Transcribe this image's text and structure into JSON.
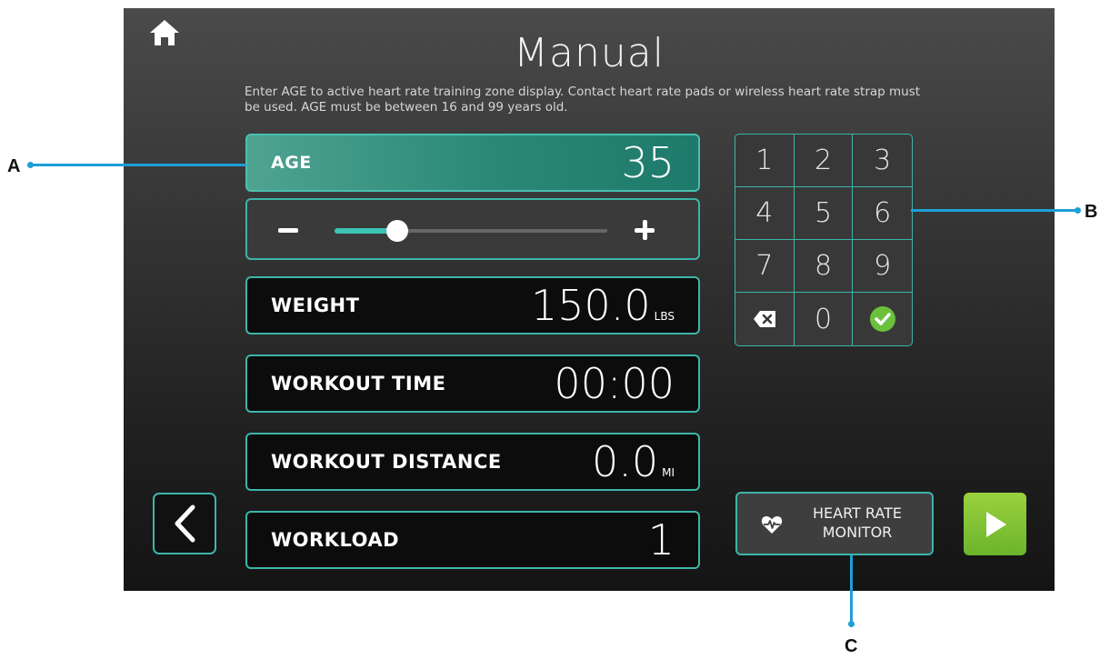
{
  "screen": {
    "title": "Manual",
    "instructions": "Enter AGE to active heart rate training zone display. Contact heart rate pads or wireless heart rate strap must be used. AGE must be between 16 and 99 years old."
  },
  "fields": {
    "age": {
      "label": "AGE",
      "value": "35"
    },
    "weight": {
      "label": "WEIGHT",
      "value": "150.0",
      "unit": "LBS"
    },
    "workout_time": {
      "label": "WORKOUT TIME",
      "value": "00:00"
    },
    "workout_distance": {
      "label": "WORKOUT DISTANCE",
      "value": "0.0",
      "unit": "MI"
    },
    "workload": {
      "label": "WORKLOAD",
      "value": "1"
    }
  },
  "age_slider": {
    "level": 0.23
  },
  "keypad": {
    "keys": [
      "1",
      "2",
      "3",
      "4",
      "5",
      "6",
      "7",
      "8",
      "9",
      "backspace-icon",
      "0",
      "check-icon"
    ]
  },
  "buttons": {
    "heart_rate_line1": "HEART RATE",
    "heart_rate_line2": "MONITOR"
  },
  "callouts": {
    "a": "A",
    "b": "B",
    "c": "C"
  },
  "colors": {
    "accent": "#3cb5a9",
    "active_field": "#2a8877",
    "play_green": "#7dc032",
    "callout_blue": "#1e9fd6"
  },
  "icons": [
    "home-icon",
    "back-chevron-icon",
    "heart-rate-icon",
    "play-icon",
    "backspace-icon",
    "check-icon",
    "minus-icon",
    "plus-icon"
  ]
}
